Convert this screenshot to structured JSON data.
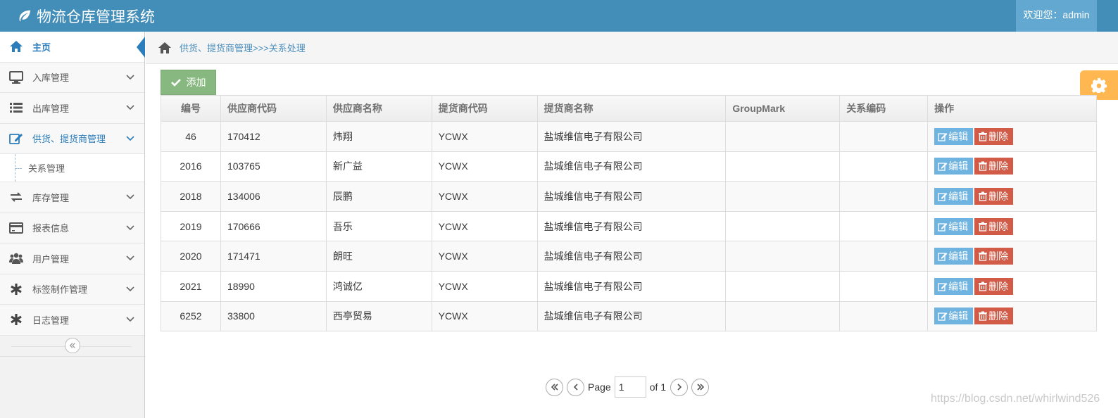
{
  "app": {
    "title": "物流仓库管理系统",
    "welcome": "欢迎您：admin"
  },
  "sidebar": {
    "items": [
      {
        "label": "主页",
        "icon": "home-icon"
      },
      {
        "label": "入库管理",
        "icon": "desktop-icon"
      },
      {
        "label": "出库管理",
        "icon": "list-icon"
      },
      {
        "label": "供货、提货商管理",
        "icon": "edit-icon"
      },
      {
        "label": "关系管理"
      },
      {
        "label": "库存管理",
        "icon": "exchange-icon"
      },
      {
        "label": "报表信息",
        "icon": "credit-card-icon"
      },
      {
        "label": "用户管理",
        "icon": "users-icon"
      },
      {
        "label": "标签制作管理",
        "icon": "asterisk-icon"
      },
      {
        "label": "日志管理",
        "icon": "asterisk-icon"
      }
    ]
  },
  "breadcrumb": {
    "text": "供货、提货商管理>>>关系处理"
  },
  "toolbar": {
    "add_label": "添加"
  },
  "table": {
    "headers": [
      "编号",
      "供应商代码",
      "供应商名称",
      "提货商代码",
      "提货商名称",
      "GroupMark",
      "关系编码",
      "操作"
    ],
    "rows": [
      [
        "46",
        "170412",
        "炜翔",
        "YCWX",
        "盐城维信电子有限公司",
        "",
        ""
      ],
      [
        "2016",
        "103765",
        "新广益",
        "YCWX",
        "盐城维信电子有限公司",
        "",
        ""
      ],
      [
        "2018",
        "134006",
        "辰鹏",
        "YCWX",
        "盐城维信电子有限公司",
        "",
        ""
      ],
      [
        "2019",
        "170666",
        "吾乐",
        "YCWX",
        "盐城维信电子有限公司",
        "",
        ""
      ],
      [
        "2020",
        "171471",
        "朗旺",
        "YCWX",
        "盐城维信电子有限公司",
        "",
        ""
      ],
      [
        "2021",
        "18990",
        "鸿诚亿",
        "YCWX",
        "盐城维信电子有限公司",
        "",
        ""
      ],
      [
        "6252",
        "33800",
        "西亭贸易",
        "YCWX",
        "盐城维信电子有限公司",
        "",
        ""
      ]
    ],
    "edit_label": "编辑",
    "delete_label": "删除"
  },
  "pager": {
    "page_label": "Page",
    "current": "1",
    "of_label": "of 1"
  },
  "watermark": "https://blog.csdn.net/whirlwind526",
  "colors": {
    "navbar": "#438eb9",
    "accent": "#2b7dbc",
    "add": "#87b87f",
    "edit": "#6fb3e0",
    "delete": "#d15b47",
    "settings": "#ffb752"
  }
}
